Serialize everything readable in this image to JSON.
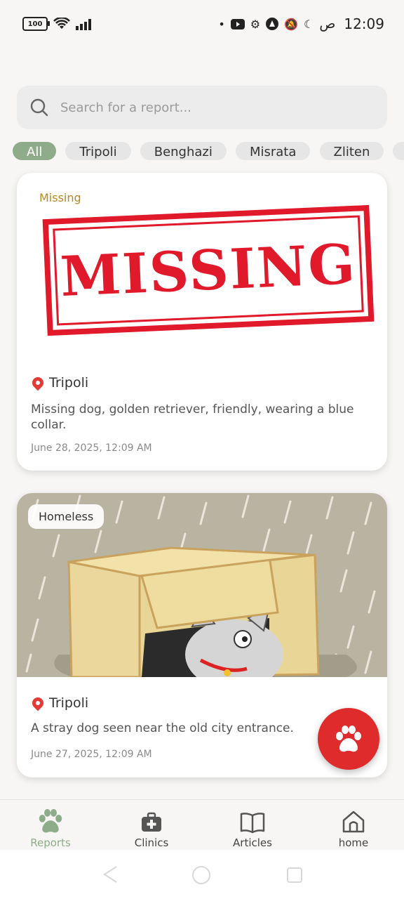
{
  "status_bar": {
    "battery": "100",
    "time": "12:09",
    "am_pm": "ص"
  },
  "search": {
    "placeholder": "Search for a report..."
  },
  "filters": [
    "All",
    "Tripoli",
    "Benghazi",
    "Misrata",
    "Zliten"
  ],
  "reports": [
    {
      "tag": "Missing",
      "image_text": "MISSING",
      "location": "Tripoli",
      "description": "Missing dog, golden retriever, friendly, wearing a blue collar.",
      "date": "June 28, 2025, 12:09 AM"
    },
    {
      "tag": "Homeless",
      "location": "Tripoli",
      "description": "A stray dog seen near the old city entrance.",
      "date": "June 27, 2025, 12:09 AM"
    }
  ],
  "bottom_nav": [
    {
      "label": "Reports",
      "icon": "paw-icon",
      "active": true
    },
    {
      "label": "Clinics",
      "icon": "medical-bag-icon",
      "active": false
    },
    {
      "label": "Articles",
      "icon": "book-icon",
      "active": false
    },
    {
      "label": "home",
      "icon": "home-icon",
      "active": false
    }
  ],
  "colors": {
    "accent_green": "#8fac8a",
    "fab_red": "#df2b2b",
    "missing_tag": "#b38a1c"
  }
}
